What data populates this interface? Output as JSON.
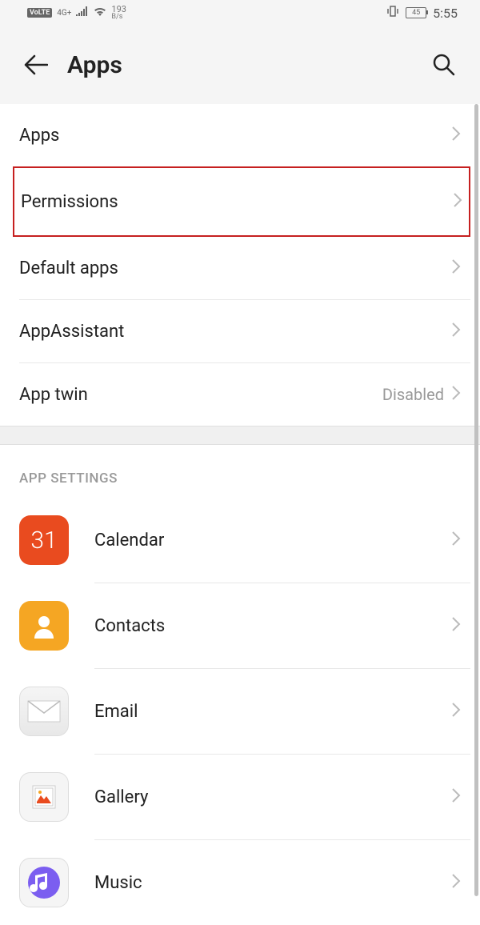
{
  "status_bar": {
    "volte": "VoLTE",
    "network": "4G+",
    "speed_num": "193",
    "speed_unit": "B/s",
    "battery": "45",
    "time": "5:55"
  },
  "header": {
    "title": "Apps"
  },
  "menu": {
    "apps": "Apps",
    "permissions": "Permissions",
    "default_apps": "Default apps",
    "app_assistant": "AppAssistant",
    "app_twin": "App twin",
    "app_twin_value": "Disabled"
  },
  "section": {
    "title": "APP SETTINGS"
  },
  "apps": [
    {
      "label": "Calendar",
      "icon_text": "31"
    },
    {
      "label": "Contacts"
    },
    {
      "label": "Email"
    },
    {
      "label": "Gallery"
    },
    {
      "label": "Music"
    }
  ]
}
